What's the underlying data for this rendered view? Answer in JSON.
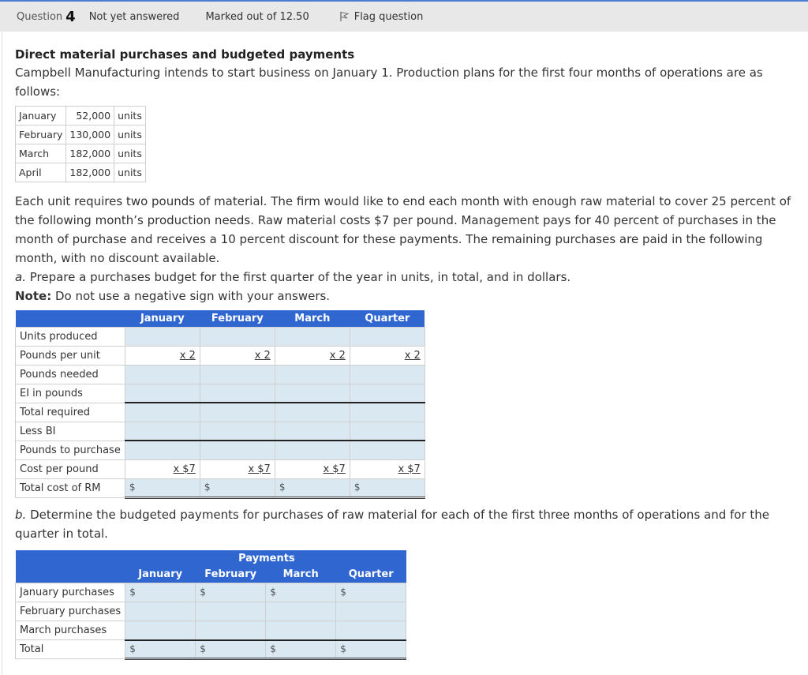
{
  "header": {
    "question_label": "Question",
    "question_number": "4",
    "state": "Not yet answered",
    "marks": "Marked out of 12.50",
    "flag_label": "Flag question",
    "flag_icon": "flag-icon"
  },
  "problem": {
    "title": "Direct material purchases and budgeted payments",
    "intro": "Campbell Manufacturing intends to start business on January 1. Production plans for the first four months of operations are as follows:",
    "production": [
      {
        "month": "January",
        "value": "52,000",
        "unit": "units"
      },
      {
        "month": "February",
        "value": "130,000",
        "unit": "units"
      },
      {
        "month": "March",
        "value": "182,000",
        "unit": "units"
      },
      {
        "month": "April",
        "value": "182,000",
        "unit": "units"
      }
    ],
    "details": "Each unit requires two pounds of material. The firm would like to end each month with enough raw material to cover 25 percent of the following month’s production needs. Raw material costs $7 per pound. Management pays for 40 percent of purchases in the month of purchase and receives a 10 percent discount for these payments. The remaining purchases are paid in the following month, with no discount available.",
    "part_a_letter": "a.",
    "part_a_text": " Prepare a purchases budget for the first quarter of the year in units, in total, and in dollars.",
    "note_label": "Note:",
    "note_text": " Do not use a negative sign with your answers.",
    "part_b_letter": "b.",
    "part_b_text": " Determine the budgeted payments for purchases of raw material for each of the first three months of operations and for the quarter in total."
  },
  "purchases_budget": {
    "columns": [
      "January",
      "February",
      "March",
      "Quarter"
    ],
    "rows": {
      "units_produced": "Units produced",
      "pounds_per_unit": "Pounds per unit",
      "pounds_needed": "Pounds needed",
      "ei_pounds": "EI in pounds",
      "total_required": "Total required",
      "less_bi": "Less BI",
      "pounds_to_purchase": "Pounds to purchase",
      "cost_per_pound": "Cost per pound",
      "total_cost": "Total cost of RM"
    },
    "pounds_per_unit_value": "x 2",
    "cost_per_pound_value": "x $7",
    "currency_symbol": "$"
  },
  "payments_budget": {
    "group_header": "Payments",
    "columns": [
      "January",
      "February",
      "March",
      "Quarter"
    ],
    "rows": {
      "jan": "January purchases",
      "feb": "February purchases",
      "mar": "March purchases",
      "total": "Total"
    },
    "currency_symbol": "$"
  }
}
